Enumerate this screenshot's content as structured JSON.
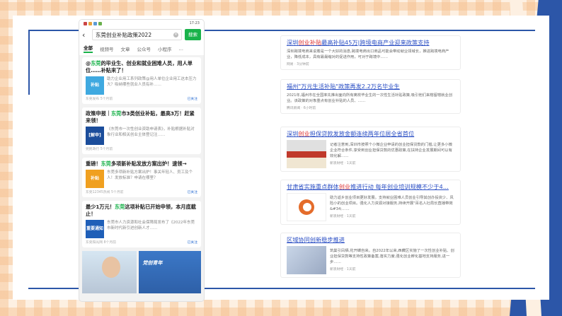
{
  "phone": {
    "status_time": "17:23",
    "search_query": "东莞创业补贴政策2022",
    "search_button": "搜索",
    "tabs": [
      "全部",
      "视频号",
      "文章",
      "公众号",
      "小程序",
      "…"
    ],
    "results": [
      {
        "title_pre": "@",
        "title_hl": "东莞",
        "title_post": "的毕业生、创业和就业困难人员，用人单位……补贴来了！",
        "thumb_text": "补贴",
        "desc": "助力企业用工系列政策@用人单位企业用工这本压力大？吸纳哪些就业人员有补……",
        "source": "东莞发布 5个月前",
        "tag": "已关注"
      },
      {
        "title_pre": "政策申报｜",
        "title_hl": "东莞",
        "title_post": "市3类创业补贴，最高3万！赶紧来领！",
        "thumb_text": "[解申]",
        "desc": "《东莞市一次性创业资助申请表》，补贴根据补贴对象行业和相关创业主体登记注……",
        "source": "莞民政行 5个月前",
        "tag": ""
      },
      {
        "title_pre": "重磅！",
        "title_hl": "东莞",
        "title_post": "多项新补贴发放方案出炉！速领→",
        "thumb_text": "补贴",
        "desc": "东莞多项新补贴方案出炉！事关年轻人、员工及个人！发放标准？申请在哪里？",
        "source": "东莞12345热线 5个月前",
        "tag": "已关注"
      },
      {
        "title_pre": "最少1万元！",
        "title_hl": "东莞",
        "title_post": "这项补贴已开始申领，本月底截止！",
        "thumb_text": "重要通知",
        "desc": "东莞市人力资源和社会保障局发布了《2022年东莞市新时代新引进创新人才……",
        "source": "东莞阳光网 8个月前",
        "tag": "已关注"
      }
    ],
    "bottom_image_text": "党创青年"
  },
  "web_results": [
    {
      "title_pre": "深圳",
      "title_red": "创业补贴",
      "title_post": "最高补贴45万|跨境电商产业迎来政策支持",
      "desc": "深圳跨境电商来说着是一个大好的消息,跨境电商出口商品可能会带动就业领域长，推进跨境电商产业，降低成本，具有最最缩对的促进作用，可对于跨境中……",
      "meta": "网易 · 3分钟前"
    },
    {
      "title_pre": "福州\"万元生活补贴\"政策再发2.2万名毕业生",
      "title_red": "",
      "title_post": "",
      "desc": "2021年,福州市在全国率先推出面向所有离校毕业生的一次性生活补贴政策,吸引他们来榕留榕就业创业。该政策的对象重点有创业补贴的人员、……",
      "meta": "腾讯新闻 · 6小时前"
    },
    {
      "title_pre": "深圳",
      "title_red": "创业",
      "title_post": "担保贷款发放金额连续两年位居全省首位",
      "desc": "记者注意到,深圳市按照个小微企业申请的创业担保贷款的门槛,让更多小微企业符合条件,享受到创业担保贷款的优惠政策,在扶持企业发展期间可以有效化解……",
      "meta": "新浪财经 · 1天前"
    },
    {
      "title_pre": "甘肃省实施重点群体",
      "title_red": "创业",
      "title_post": "推进行动 每年创业培训规模不少于4…",
      "desc": "助力返乡创业项目更好发展。支持就业困难人员创业引导其创办投资少、风险小的创业项目。强化人力资源对接服务,持续开展\"百名人社局长直播带岗&#34;……",
      "meta": "新浪财经 · 1天前"
    },
    {
      "title_pre": "区域协同创新稳步推进",
      "title_red": "",
      "title_post": "",
      "desc": "筑巢引凤栖,花开蝶自来。自2022年以来,西藏区实施了一次性创业补贴、创业担保贷款等支持性政策备案,落实力度,强化创业孵化基地支持服务,进一步……",
      "meta": "新浪财经 · 1天前"
    }
  ],
  "colors": {
    "frame_blue": "#2c56a8",
    "wechat_green": "#19b24a",
    "link_blue": "#2b4fc4",
    "highlight_red": "#d33"
  }
}
